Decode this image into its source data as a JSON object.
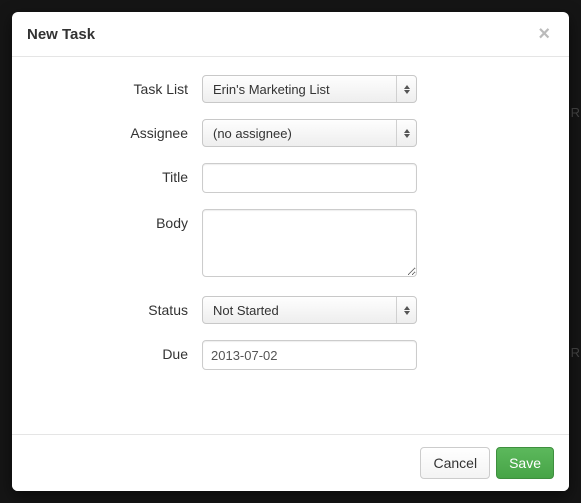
{
  "modal": {
    "title": "New Task",
    "close_aria": "Close"
  },
  "fields": {
    "task_list": {
      "label": "Task List",
      "value": "Erin's Marketing List"
    },
    "assignee": {
      "label": "Assignee",
      "value": "(no assignee)"
    },
    "title": {
      "label": "Title",
      "value": ""
    },
    "body": {
      "label": "Body",
      "value": ""
    },
    "status": {
      "label": "Status",
      "value": "Not Started"
    },
    "due": {
      "label": "Due",
      "value": "2013-07-02"
    }
  },
  "footer": {
    "cancel": "Cancel",
    "save": "Save"
  },
  "bg_hints": {
    "a": "R",
    "b": "R"
  }
}
